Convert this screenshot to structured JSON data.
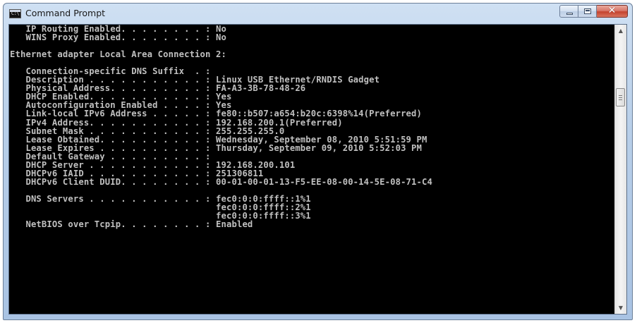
{
  "window": {
    "title": "Command Prompt",
    "icon_text": "C:\\",
    "icon": "console-icon",
    "close_glyph": "✕",
    "scroll_up_glyph": "▲",
    "scroll_down_glyph": "▼"
  },
  "console": {
    "lines": [
      "   IP Routing Enabled. . . . . . . . : No",
      "   WINS Proxy Enabled. . . . . . . . : No",
      "",
      "Ethernet adapter Local Area Connection 2:",
      "",
      "   Connection-specific DNS Suffix  . :",
      "   Description . . . . . . . . . . . : Linux USB Ethernet/RNDIS Gadget",
      "   Physical Address. . . . . . . . . : FA-A3-3B-78-48-26",
      "   DHCP Enabled. . . . . . . . . . . : Yes",
      "   Autoconfiguration Enabled . . . . : Yes",
      "   Link-local IPv6 Address . . . . . : fe80::b507:a654:b20c:6398%14(Preferred)",
      "   IPv4 Address. . . . . . . . . . . : 192.168.200.1(Preferred)",
      "   Subnet Mask . . . . . . . . . . . : 255.255.255.0",
      "   Lease Obtained. . . . . . . . . . : Wednesday, September 08, 2010 5:51:59 PM",
      "   Lease Expires . . . . . . . . . . : Thursday, September 09, 2010 5:52:03 PM",
      "   Default Gateway . . . . . . . . . :",
      "   DHCP Server . . . . . . . . . . . : 192.168.200.101",
      "   DHCPv6 IAID . . . . . . . . . . . : 251306811",
      "   DHCPv6 Client DUID. . . . . . . . : 00-01-00-01-13-F5-EE-08-00-14-5E-08-71-C4",
      "",
      "   DNS Servers . . . . . . . . . . . : fec0:0:0:ffff::1%1",
      "                                       fec0:0:0:ffff::2%1",
      "                                       fec0:0:0:ffff::3%1",
      "   NetBIOS over Tcpip. . . . . . . . : Enabled"
    ]
  },
  "colors": {
    "console_bg": "#000000",
    "console_text": "#c0c0c0",
    "close_button": "#c4422e"
  }
}
